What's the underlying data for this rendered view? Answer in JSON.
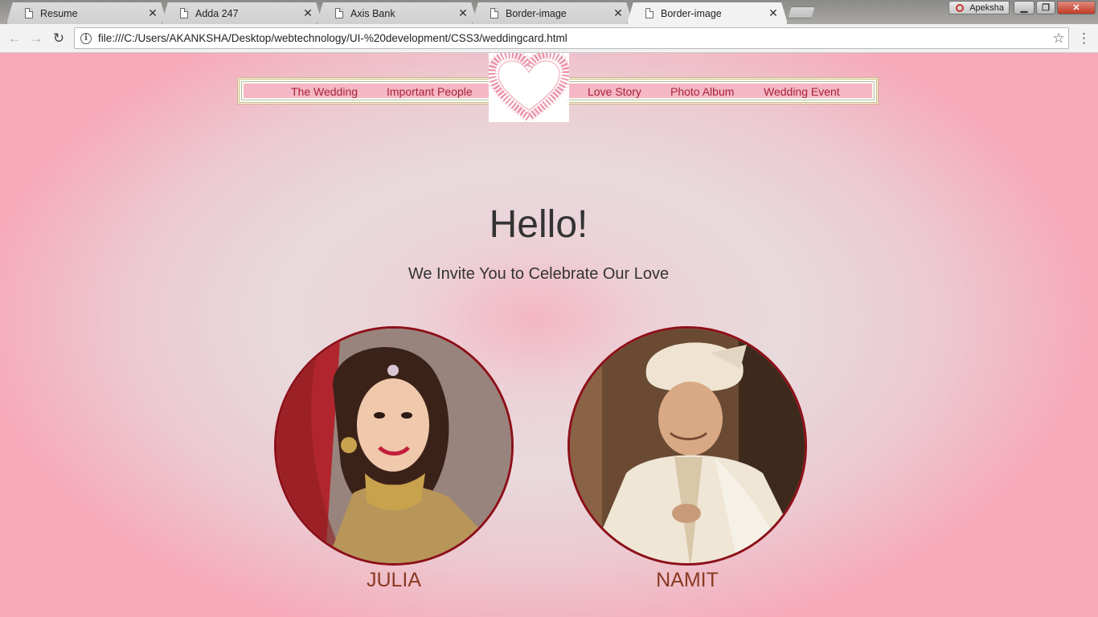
{
  "browser": {
    "tabs": [
      {
        "title": "Resume"
      },
      {
        "title": "Adda 247"
      },
      {
        "title": "Axis Bank"
      },
      {
        "title": "Border-image"
      },
      {
        "title": "Border-image"
      }
    ],
    "active_tab_index": 4,
    "profile_name": "Apeksha",
    "address_url": "file:///C:/Users/AKANKSHA/Desktop/webtechnology/UI-%20development/CSS3/weddingcard.html"
  },
  "page": {
    "nav": {
      "left": [
        "The Wedding",
        "Important People"
      ],
      "right": [
        "Love Story",
        "Photo Album",
        "Wedding Event"
      ]
    },
    "heading": "Hello!",
    "subheading": "We Invite You to Celebrate Our Love",
    "bride": {
      "name": "JULIA"
    },
    "groom": {
      "name": "NAMIT"
    }
  },
  "colors": {
    "nav_text": "#a8233d",
    "portrait_border": "#8d0f18",
    "name_text": "#8a3a22",
    "heart_lace": "#e8869f"
  },
  "icons": {
    "tab": "document-icon",
    "tab_close": "close-icon",
    "back": "back-arrow-icon",
    "forward": "forward-arrow-icon",
    "reload": "reload-icon",
    "site_info": "info-icon",
    "bookmark": "star-icon",
    "menu": "kebab-menu-icon",
    "logo": "lace-heart-icon"
  }
}
